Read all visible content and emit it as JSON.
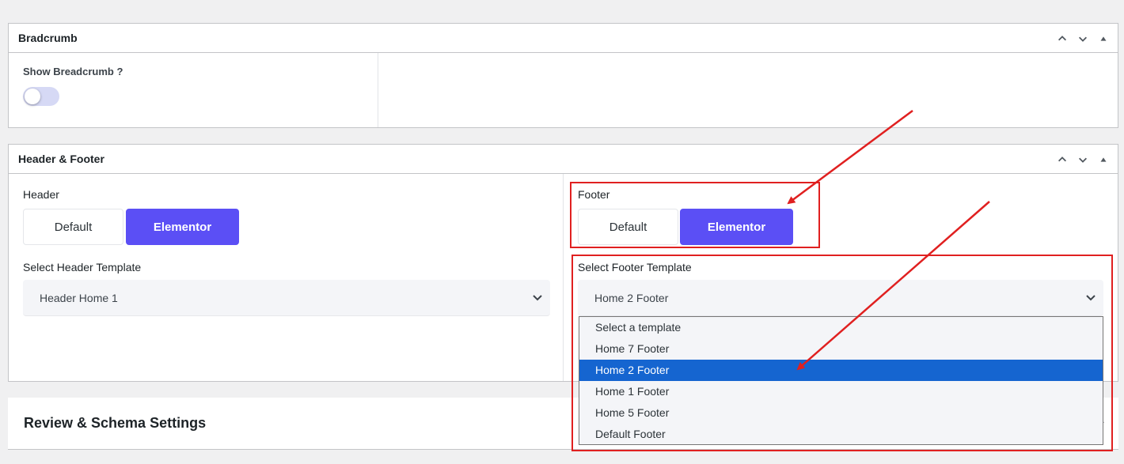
{
  "breadcrumb_panel": {
    "title": "Bradcrumb",
    "show_label": "Show Breadcrumb ?",
    "toggle_on": false
  },
  "header_footer_panel": {
    "title": "Header & Footer",
    "header": {
      "label": "Header",
      "options": [
        "Default",
        "Elementor"
      ],
      "active": "Elementor",
      "template_label": "Select Header Template",
      "template_value": "Header Home 1"
    },
    "footer": {
      "label": "Footer",
      "options": [
        "Default",
        "Elementor"
      ],
      "active": "Elementor",
      "template_label": "Select Footer Template",
      "template_value": "Home 2 Footer",
      "dropdown_options": [
        "Select a template",
        "Home 7 Footer",
        "Home 2 Footer",
        "Home 1 Footer",
        "Home 5 Footer",
        "Default Footer"
      ],
      "dropdown_selected": "Home 2 Footer"
    }
  },
  "review_panel": {
    "title": "Review & Schema Settings"
  },
  "colors": {
    "accent": "#5b4ff5",
    "selection": "#1565d0",
    "annotation": "#e02020"
  },
  "icons": [
    "chevron-up-icon",
    "chevron-down-icon",
    "triangle-up-icon",
    "select-chevron-icon",
    "annotation-arrow"
  ]
}
